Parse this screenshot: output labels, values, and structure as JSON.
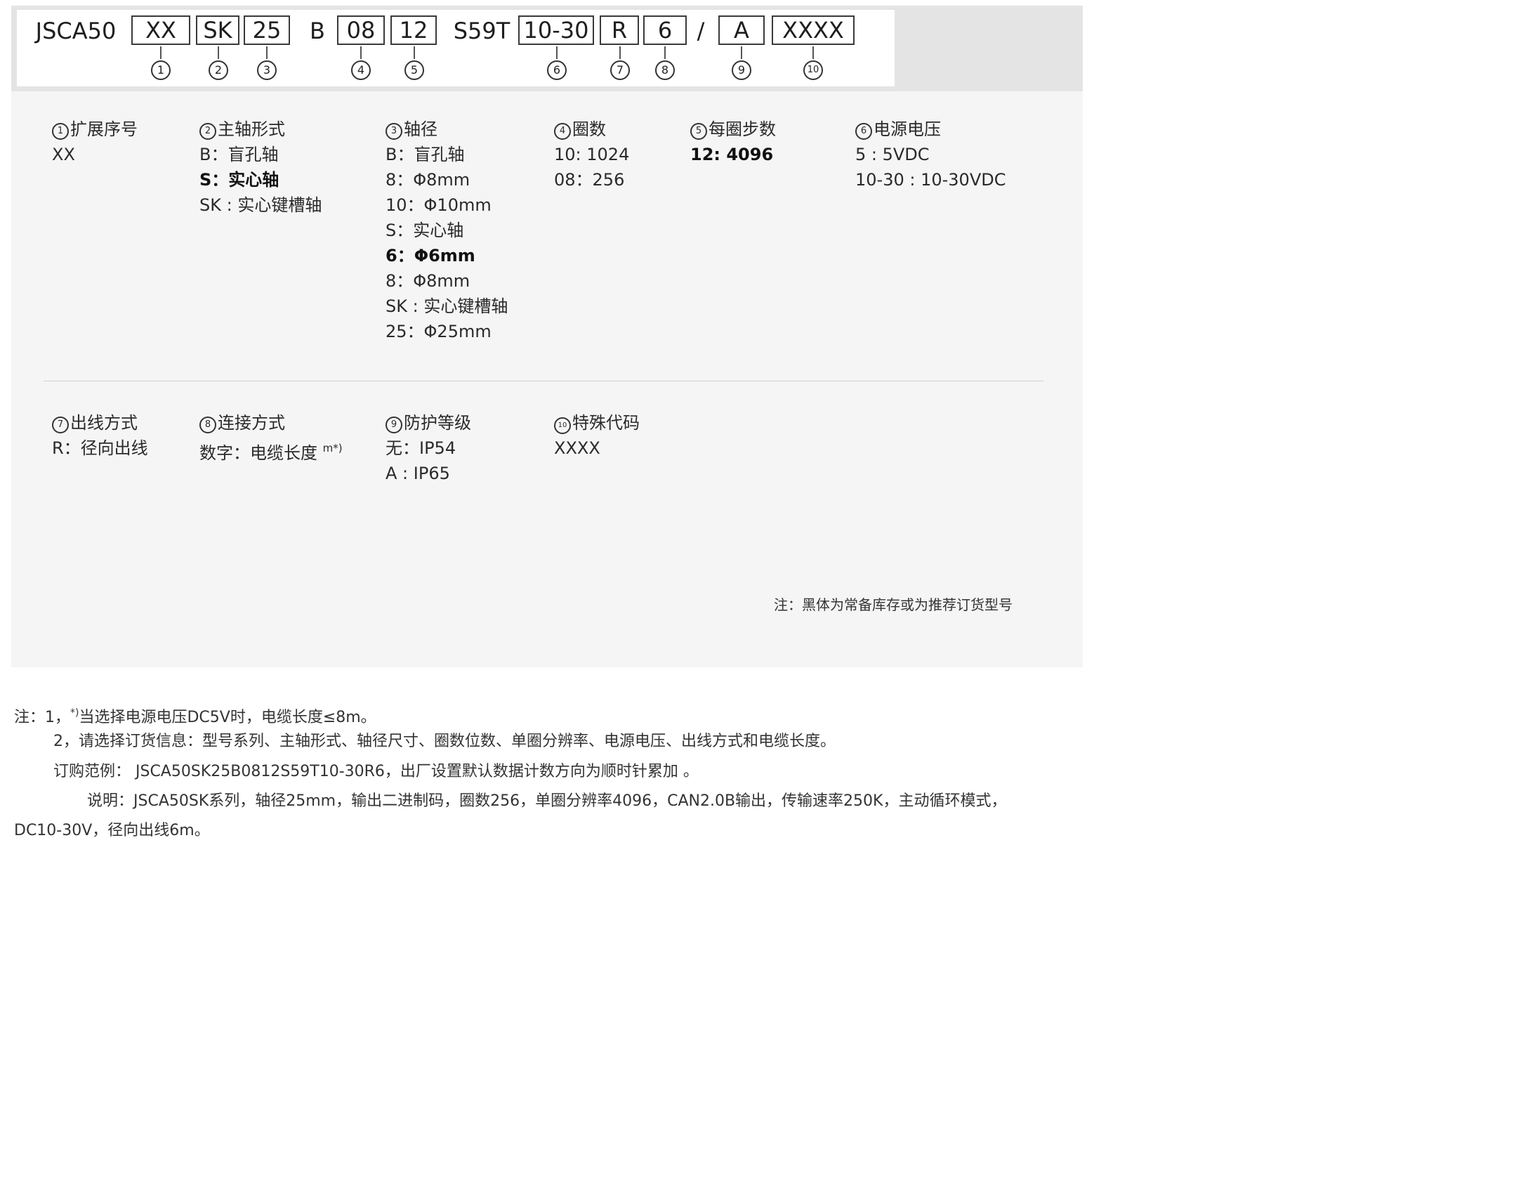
{
  "model_code": {
    "prefix": "JSCA50",
    "seg1": "XX",
    "seg2": "SK",
    "seg3": "25",
    "sep1": "B",
    "seg4": "08",
    "seg5": "12",
    "sep2": "S59T",
    "seg6": "10-30",
    "seg7": "R",
    "seg8": "6",
    "slash": "/",
    "seg9": "A",
    "seg10": "XXXX",
    "markers": [
      "1",
      "2",
      "3",
      "4",
      "5",
      "6",
      "7",
      "8",
      "9",
      "10"
    ]
  },
  "columns": {
    "c1": {
      "num": "1",
      "title": "扩展序号",
      "items": [
        "XX"
      ]
    },
    "c2": {
      "num": "2",
      "title": "主轴形式",
      "items": [
        "B：盲孔轴",
        "S：实心轴",
        "SK : 实心键槽轴"
      ]
    },
    "c3": {
      "num": "3",
      "title": "轴径",
      "items": [
        "B：盲孔轴",
        "8：Φ8mm",
        "10：Φ10mm",
        "S：实心轴",
        "6：Φ6mm",
        "8：Φ8mm",
        "SK : 实心键槽轴",
        "25：Φ25mm"
      ]
    },
    "c4": {
      "num": "4",
      "title": "圈数",
      "items": [
        "10: 1024",
        "08：256"
      ]
    },
    "c5": {
      "num": "5",
      "title": "每圈步数",
      "items": [
        "12: 4096"
      ]
    },
    "c6": {
      "num": "6",
      "title": "电源电压",
      "items": [
        "5 : 5VDC",
        "10-30 : 10-30VDC"
      ]
    },
    "c7": {
      "num": "7",
      "title": "出线方式",
      "items": [
        "R：径向出线"
      ]
    },
    "c8": {
      "num": "8",
      "title": "连接方式",
      "items": [
        "数字：电缆长度 "
      ],
      "sup": "m*)"
    },
    "c9": {
      "num": "9",
      "title": "防护等级",
      "items": [
        "无：IP54",
        "A : IP65"
      ]
    },
    "c10": {
      "num": "10",
      "title": "特殊代码",
      "items": [
        "XXXX"
      ]
    }
  },
  "panel_note": "注：黑体为常备库存或为推荐订货型号",
  "footnotes": {
    "line1_prefix": "注：1，",
    "line1_sup": "*)",
    "line1_text": "当选择电源电压DC5V时，电缆长度≤8m。",
    "line2": "2，请选择订货信息：型号系列、主轴形式、轴径尺寸、圈数位数、单圈分辨率、电源电压、出线方式和电缆长度。",
    "line3": "订购范例： JSCA50SK25B0812S59T10-30R6，出厂设置默认数据计数方向为顺时针累加 。",
    "line4": "说明：JSCA50SK系列，轴径25mm，输出二进制码，圈数256，单圈分辨率4096，CAN2.0B输出，传输速率250K，主动循环模式，",
    "line5": "DC10-30V，径向出线6m。"
  }
}
